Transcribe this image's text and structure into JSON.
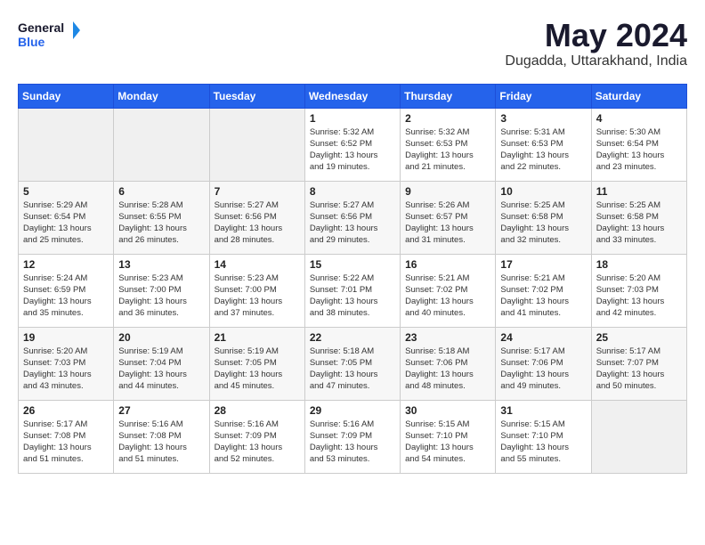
{
  "header": {
    "logo_general": "General",
    "logo_blue": "Blue",
    "month": "May 2024",
    "location": "Dugadda, Uttarakhand, India"
  },
  "days_of_week": [
    "Sunday",
    "Monday",
    "Tuesday",
    "Wednesday",
    "Thursday",
    "Friday",
    "Saturday"
  ],
  "weeks": [
    [
      {
        "day": "",
        "info": ""
      },
      {
        "day": "",
        "info": ""
      },
      {
        "day": "",
        "info": ""
      },
      {
        "day": "1",
        "info": "Sunrise: 5:32 AM\nSunset: 6:52 PM\nDaylight: 13 hours\nand 19 minutes."
      },
      {
        "day": "2",
        "info": "Sunrise: 5:32 AM\nSunset: 6:53 PM\nDaylight: 13 hours\nand 21 minutes."
      },
      {
        "day": "3",
        "info": "Sunrise: 5:31 AM\nSunset: 6:53 PM\nDaylight: 13 hours\nand 22 minutes."
      },
      {
        "day": "4",
        "info": "Sunrise: 5:30 AM\nSunset: 6:54 PM\nDaylight: 13 hours\nand 23 minutes."
      }
    ],
    [
      {
        "day": "5",
        "info": "Sunrise: 5:29 AM\nSunset: 6:54 PM\nDaylight: 13 hours\nand 25 minutes."
      },
      {
        "day": "6",
        "info": "Sunrise: 5:28 AM\nSunset: 6:55 PM\nDaylight: 13 hours\nand 26 minutes."
      },
      {
        "day": "7",
        "info": "Sunrise: 5:27 AM\nSunset: 6:56 PM\nDaylight: 13 hours\nand 28 minutes."
      },
      {
        "day": "8",
        "info": "Sunrise: 5:27 AM\nSunset: 6:56 PM\nDaylight: 13 hours\nand 29 minutes."
      },
      {
        "day": "9",
        "info": "Sunrise: 5:26 AM\nSunset: 6:57 PM\nDaylight: 13 hours\nand 31 minutes."
      },
      {
        "day": "10",
        "info": "Sunrise: 5:25 AM\nSunset: 6:58 PM\nDaylight: 13 hours\nand 32 minutes."
      },
      {
        "day": "11",
        "info": "Sunrise: 5:25 AM\nSunset: 6:58 PM\nDaylight: 13 hours\nand 33 minutes."
      }
    ],
    [
      {
        "day": "12",
        "info": "Sunrise: 5:24 AM\nSunset: 6:59 PM\nDaylight: 13 hours\nand 35 minutes."
      },
      {
        "day": "13",
        "info": "Sunrise: 5:23 AM\nSunset: 7:00 PM\nDaylight: 13 hours\nand 36 minutes."
      },
      {
        "day": "14",
        "info": "Sunrise: 5:23 AM\nSunset: 7:00 PM\nDaylight: 13 hours\nand 37 minutes."
      },
      {
        "day": "15",
        "info": "Sunrise: 5:22 AM\nSunset: 7:01 PM\nDaylight: 13 hours\nand 38 minutes."
      },
      {
        "day": "16",
        "info": "Sunrise: 5:21 AM\nSunset: 7:02 PM\nDaylight: 13 hours\nand 40 minutes."
      },
      {
        "day": "17",
        "info": "Sunrise: 5:21 AM\nSunset: 7:02 PM\nDaylight: 13 hours\nand 41 minutes."
      },
      {
        "day": "18",
        "info": "Sunrise: 5:20 AM\nSunset: 7:03 PM\nDaylight: 13 hours\nand 42 minutes."
      }
    ],
    [
      {
        "day": "19",
        "info": "Sunrise: 5:20 AM\nSunset: 7:03 PM\nDaylight: 13 hours\nand 43 minutes."
      },
      {
        "day": "20",
        "info": "Sunrise: 5:19 AM\nSunset: 7:04 PM\nDaylight: 13 hours\nand 44 minutes."
      },
      {
        "day": "21",
        "info": "Sunrise: 5:19 AM\nSunset: 7:05 PM\nDaylight: 13 hours\nand 45 minutes."
      },
      {
        "day": "22",
        "info": "Sunrise: 5:18 AM\nSunset: 7:05 PM\nDaylight: 13 hours\nand 47 minutes."
      },
      {
        "day": "23",
        "info": "Sunrise: 5:18 AM\nSunset: 7:06 PM\nDaylight: 13 hours\nand 48 minutes."
      },
      {
        "day": "24",
        "info": "Sunrise: 5:17 AM\nSunset: 7:06 PM\nDaylight: 13 hours\nand 49 minutes."
      },
      {
        "day": "25",
        "info": "Sunrise: 5:17 AM\nSunset: 7:07 PM\nDaylight: 13 hours\nand 50 minutes."
      }
    ],
    [
      {
        "day": "26",
        "info": "Sunrise: 5:17 AM\nSunset: 7:08 PM\nDaylight: 13 hours\nand 51 minutes."
      },
      {
        "day": "27",
        "info": "Sunrise: 5:16 AM\nSunset: 7:08 PM\nDaylight: 13 hours\nand 51 minutes."
      },
      {
        "day": "28",
        "info": "Sunrise: 5:16 AM\nSunset: 7:09 PM\nDaylight: 13 hours\nand 52 minutes."
      },
      {
        "day": "29",
        "info": "Sunrise: 5:16 AM\nSunset: 7:09 PM\nDaylight: 13 hours\nand 53 minutes."
      },
      {
        "day": "30",
        "info": "Sunrise: 5:15 AM\nSunset: 7:10 PM\nDaylight: 13 hours\nand 54 minutes."
      },
      {
        "day": "31",
        "info": "Sunrise: 5:15 AM\nSunset: 7:10 PM\nDaylight: 13 hours\nand 55 minutes."
      },
      {
        "day": "",
        "info": ""
      }
    ]
  ]
}
